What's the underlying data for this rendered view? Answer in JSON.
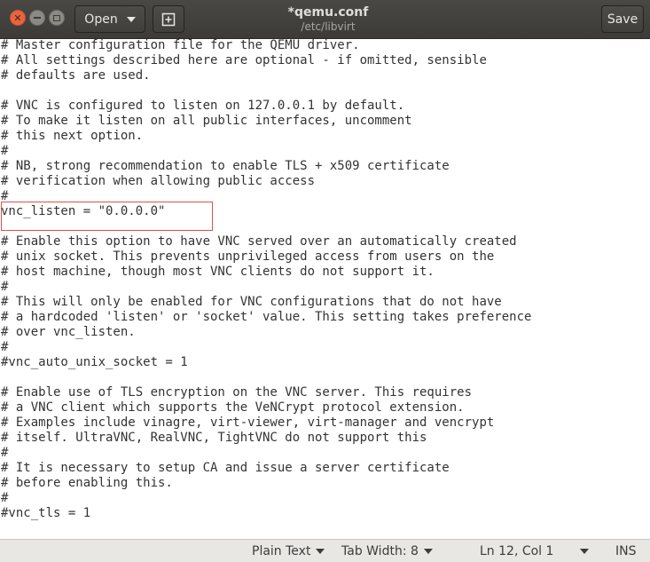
{
  "header": {
    "open_label": "Open",
    "newtab_icon": "new-tab-icon",
    "title": "*qemu.conf",
    "subtitle": "/etc/libvirt",
    "save_label": "Save",
    "window_buttons": [
      "close",
      "minimize",
      "maximize"
    ]
  },
  "editor": {
    "lines": [
      "# Master configuration file for the QEMU driver.",
      "# All settings described here are optional - if omitted, sensible",
      "# defaults are used.",
      "",
      "# VNC is configured to listen on 127.0.0.1 by default.",
      "# To make it listen on all public interfaces, uncomment",
      "# this next option.",
      "#",
      "# NB, strong recommendation to enable TLS + x509 certificate",
      "# verification when allowing public access",
      "#",
      "vnc_listen = \"0.0.0.0\"",
      "",
      "# Enable this option to have VNC served over an automatically created",
      "# unix socket. This prevents unprivileged access from users on the",
      "# host machine, though most VNC clients do not support it.",
      "#",
      "# This will only be enabled for VNC configurations that do not have",
      "# a hardcoded 'listen' or 'socket' value. This setting takes preference",
      "# over vnc_listen.",
      "#",
      "#vnc_auto_unix_socket = 1",
      "",
      "# Enable use of TLS encryption on the VNC server. This requires",
      "# a VNC client which supports the VeNCrypt protocol extension.",
      "# Examples include vinagre, virt-viewer, virt-manager and vencrypt",
      "# itself. UltraVNC, RealVNC, TightVNC do not support this",
      "#",
      "# It is necessary to setup CA and issue a server certificate",
      "# before enabling this.",
      "#",
      "#vnc_tls = 1"
    ]
  },
  "statusbar": {
    "language": "Plain Text",
    "tab_width": "Tab Width: 8",
    "position": "Ln 12, Col 1",
    "mode": "INS"
  },
  "colors": {
    "headerbar": "#3c3b37",
    "close_button": "#e9643f",
    "highlight_border": "#d9534f",
    "text": "#333333"
  }
}
